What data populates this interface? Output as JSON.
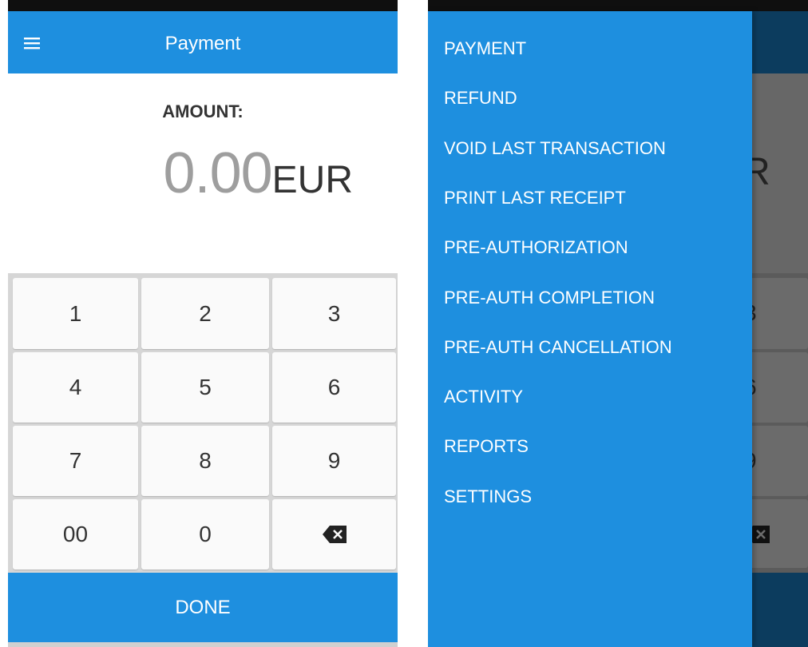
{
  "left_screen": {
    "appbar": {
      "title": "Payment"
    },
    "amount": {
      "label": "AMOUNT:",
      "value": "0.00",
      "currency": "EUR"
    },
    "keypad": [
      {
        "name": "key-1",
        "label": "1"
      },
      {
        "name": "key-2",
        "label": "2"
      },
      {
        "name": "key-3",
        "label": "3"
      },
      {
        "name": "key-4",
        "label": "4"
      },
      {
        "name": "key-5",
        "label": "5"
      },
      {
        "name": "key-6",
        "label": "6"
      },
      {
        "name": "key-7",
        "label": "7"
      },
      {
        "name": "key-8",
        "label": "8"
      },
      {
        "name": "key-9",
        "label": "9"
      },
      {
        "name": "key-00",
        "label": "00"
      },
      {
        "name": "key-0",
        "label": "0"
      },
      {
        "name": "backspace-button",
        "label": "",
        "icon": "backspace-icon"
      }
    ],
    "done_label": "DONE"
  },
  "right_screen": {
    "drawer": {
      "items": [
        {
          "name": "drawer-item-payment",
          "label": "PAYMENT"
        },
        {
          "name": "drawer-item-refund",
          "label": "REFUND"
        },
        {
          "name": "drawer-item-void-last-transaction",
          "label": "VOID LAST TRANSACTION"
        },
        {
          "name": "drawer-item-print-last-receipt",
          "label": "PRINT LAST RECEIPT"
        },
        {
          "name": "drawer-item-pre-authorization",
          "label": "PRE-AUTHORIZATION"
        },
        {
          "name": "drawer-item-pre-auth-completion",
          "label": "PRE-AUTH COMPLETION"
        },
        {
          "name": "drawer-item-pre-auth-cancellation",
          "label": "PRE-AUTH CANCELLATION"
        },
        {
          "name": "drawer-item-activity",
          "label": "ACTIVITY"
        },
        {
          "name": "drawer-item-reports",
          "label": "REPORTS"
        },
        {
          "name": "drawer-item-settings",
          "label": "SETTINGS"
        }
      ]
    },
    "background_peek": {
      "amount_fragment": "R",
      "key_fragments": [
        "3",
        "6",
        "9"
      ]
    }
  },
  "colors": {
    "primary_blue": "#1e8fdf",
    "dim_appbar": "#0c3c5e",
    "amount_gray": "#9e9e9e",
    "text_dark": "#333333"
  }
}
